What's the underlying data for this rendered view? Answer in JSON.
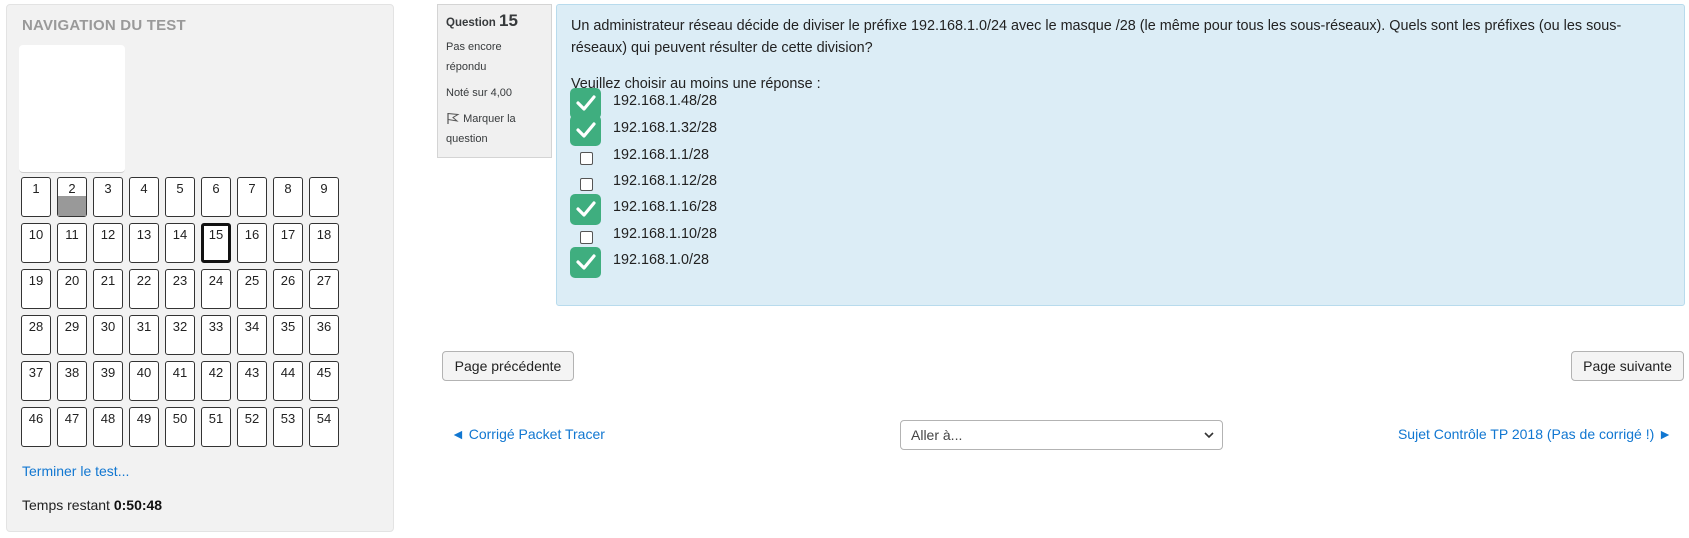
{
  "nav": {
    "title": "NAVIGATION DU TEST",
    "questions": [
      {
        "num": "1"
      },
      {
        "num": "2",
        "state": "answered"
      },
      {
        "num": "3"
      },
      {
        "num": "4"
      },
      {
        "num": "5"
      },
      {
        "num": "6"
      },
      {
        "num": "7"
      },
      {
        "num": "8"
      },
      {
        "num": "9"
      },
      {
        "num": "10"
      },
      {
        "num": "11"
      },
      {
        "num": "12"
      },
      {
        "num": "13"
      },
      {
        "num": "14"
      },
      {
        "num": "15",
        "state": "current"
      },
      {
        "num": "16"
      },
      {
        "num": "17"
      },
      {
        "num": "18"
      },
      {
        "num": "19"
      },
      {
        "num": "20"
      },
      {
        "num": "21"
      },
      {
        "num": "22"
      },
      {
        "num": "23"
      },
      {
        "num": "24"
      },
      {
        "num": "25"
      },
      {
        "num": "26"
      },
      {
        "num": "27"
      },
      {
        "num": "28"
      },
      {
        "num": "29"
      },
      {
        "num": "30"
      },
      {
        "num": "31"
      },
      {
        "num": "32"
      },
      {
        "num": "33"
      },
      {
        "num": "34"
      },
      {
        "num": "35"
      },
      {
        "num": "36"
      },
      {
        "num": "37"
      },
      {
        "num": "38"
      },
      {
        "num": "39"
      },
      {
        "num": "40"
      },
      {
        "num": "41"
      },
      {
        "num": "42"
      },
      {
        "num": "43"
      },
      {
        "num": "44"
      },
      {
        "num": "45"
      },
      {
        "num": "46"
      },
      {
        "num": "47"
      },
      {
        "num": "48"
      },
      {
        "num": "49"
      },
      {
        "num": "50"
      },
      {
        "num": "51"
      },
      {
        "num": "52"
      },
      {
        "num": "53"
      },
      {
        "num": "54"
      }
    ],
    "finish_label": "Terminer le test...",
    "timer_label": "Temps restant",
    "timer_value": "0:50:48"
  },
  "question": {
    "label": "Question",
    "number": "15",
    "state": "Pas encore répondu",
    "grade": "Noté sur 4,00",
    "flag_label": "Marquer la question",
    "text": "Un administrateur réseau décide de diviser le préfixe 192.168.1.0/24 avec le masque /28 (le même pour tous les sous-réseaux). Quels sont les préfixes (ou les sous-réseaux) qui peuvent résulter de cette division?",
    "prompt": "Veuillez choisir au moins une réponse :",
    "answers": [
      {
        "label": "192.168.1.48/28",
        "checked": true
      },
      {
        "label": "192.168.1.32/28",
        "checked": true
      },
      {
        "label": "192.168.1.1/28",
        "checked": false
      },
      {
        "label": "192.168.1.12/28",
        "checked": false
      },
      {
        "label": "192.168.1.16/28",
        "checked": true
      },
      {
        "label": "192.168.1.10/28",
        "checked": false
      },
      {
        "label": "192.168.1.0/28",
        "checked": true
      }
    ]
  },
  "buttons": {
    "prev": "Page précédente",
    "next": "Page suivante"
  },
  "activity_nav": {
    "prev_link": "◄ Corrigé Packet Tracer",
    "jump_placeholder": "Aller à...",
    "next_link": "Sujet Contrôle TP 2018 (Pas de corrigé !) ►"
  },
  "colors": {
    "check_badge": "#3fae7f",
    "question_bg": "#dcedf6",
    "link": "#1177d1"
  }
}
